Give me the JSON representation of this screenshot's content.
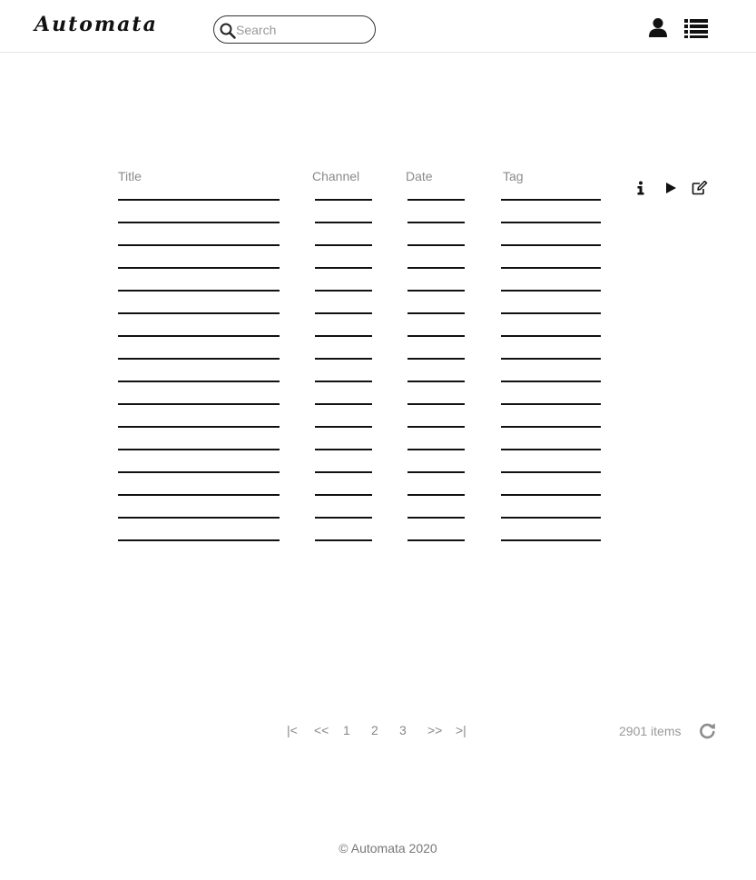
{
  "header": {
    "logo_text": "Automata",
    "search": {
      "placeholder": "Search",
      "value": ""
    },
    "icons": [
      "user-icon",
      "list-icon"
    ]
  },
  "table": {
    "columns": [
      "Title",
      "Channel",
      "Date",
      "Tag"
    ],
    "row_count": 16,
    "actions": [
      "info-icon",
      "play-icon",
      "edit-icon"
    ]
  },
  "pagination": {
    "first": "|<",
    "prev": "<<",
    "pages": [
      "1",
      "2",
      "3"
    ],
    "next": ">>",
    "last": ">|"
  },
  "item_count_text": "2901 items",
  "footer": {
    "text": "© Automata 2020"
  }
}
